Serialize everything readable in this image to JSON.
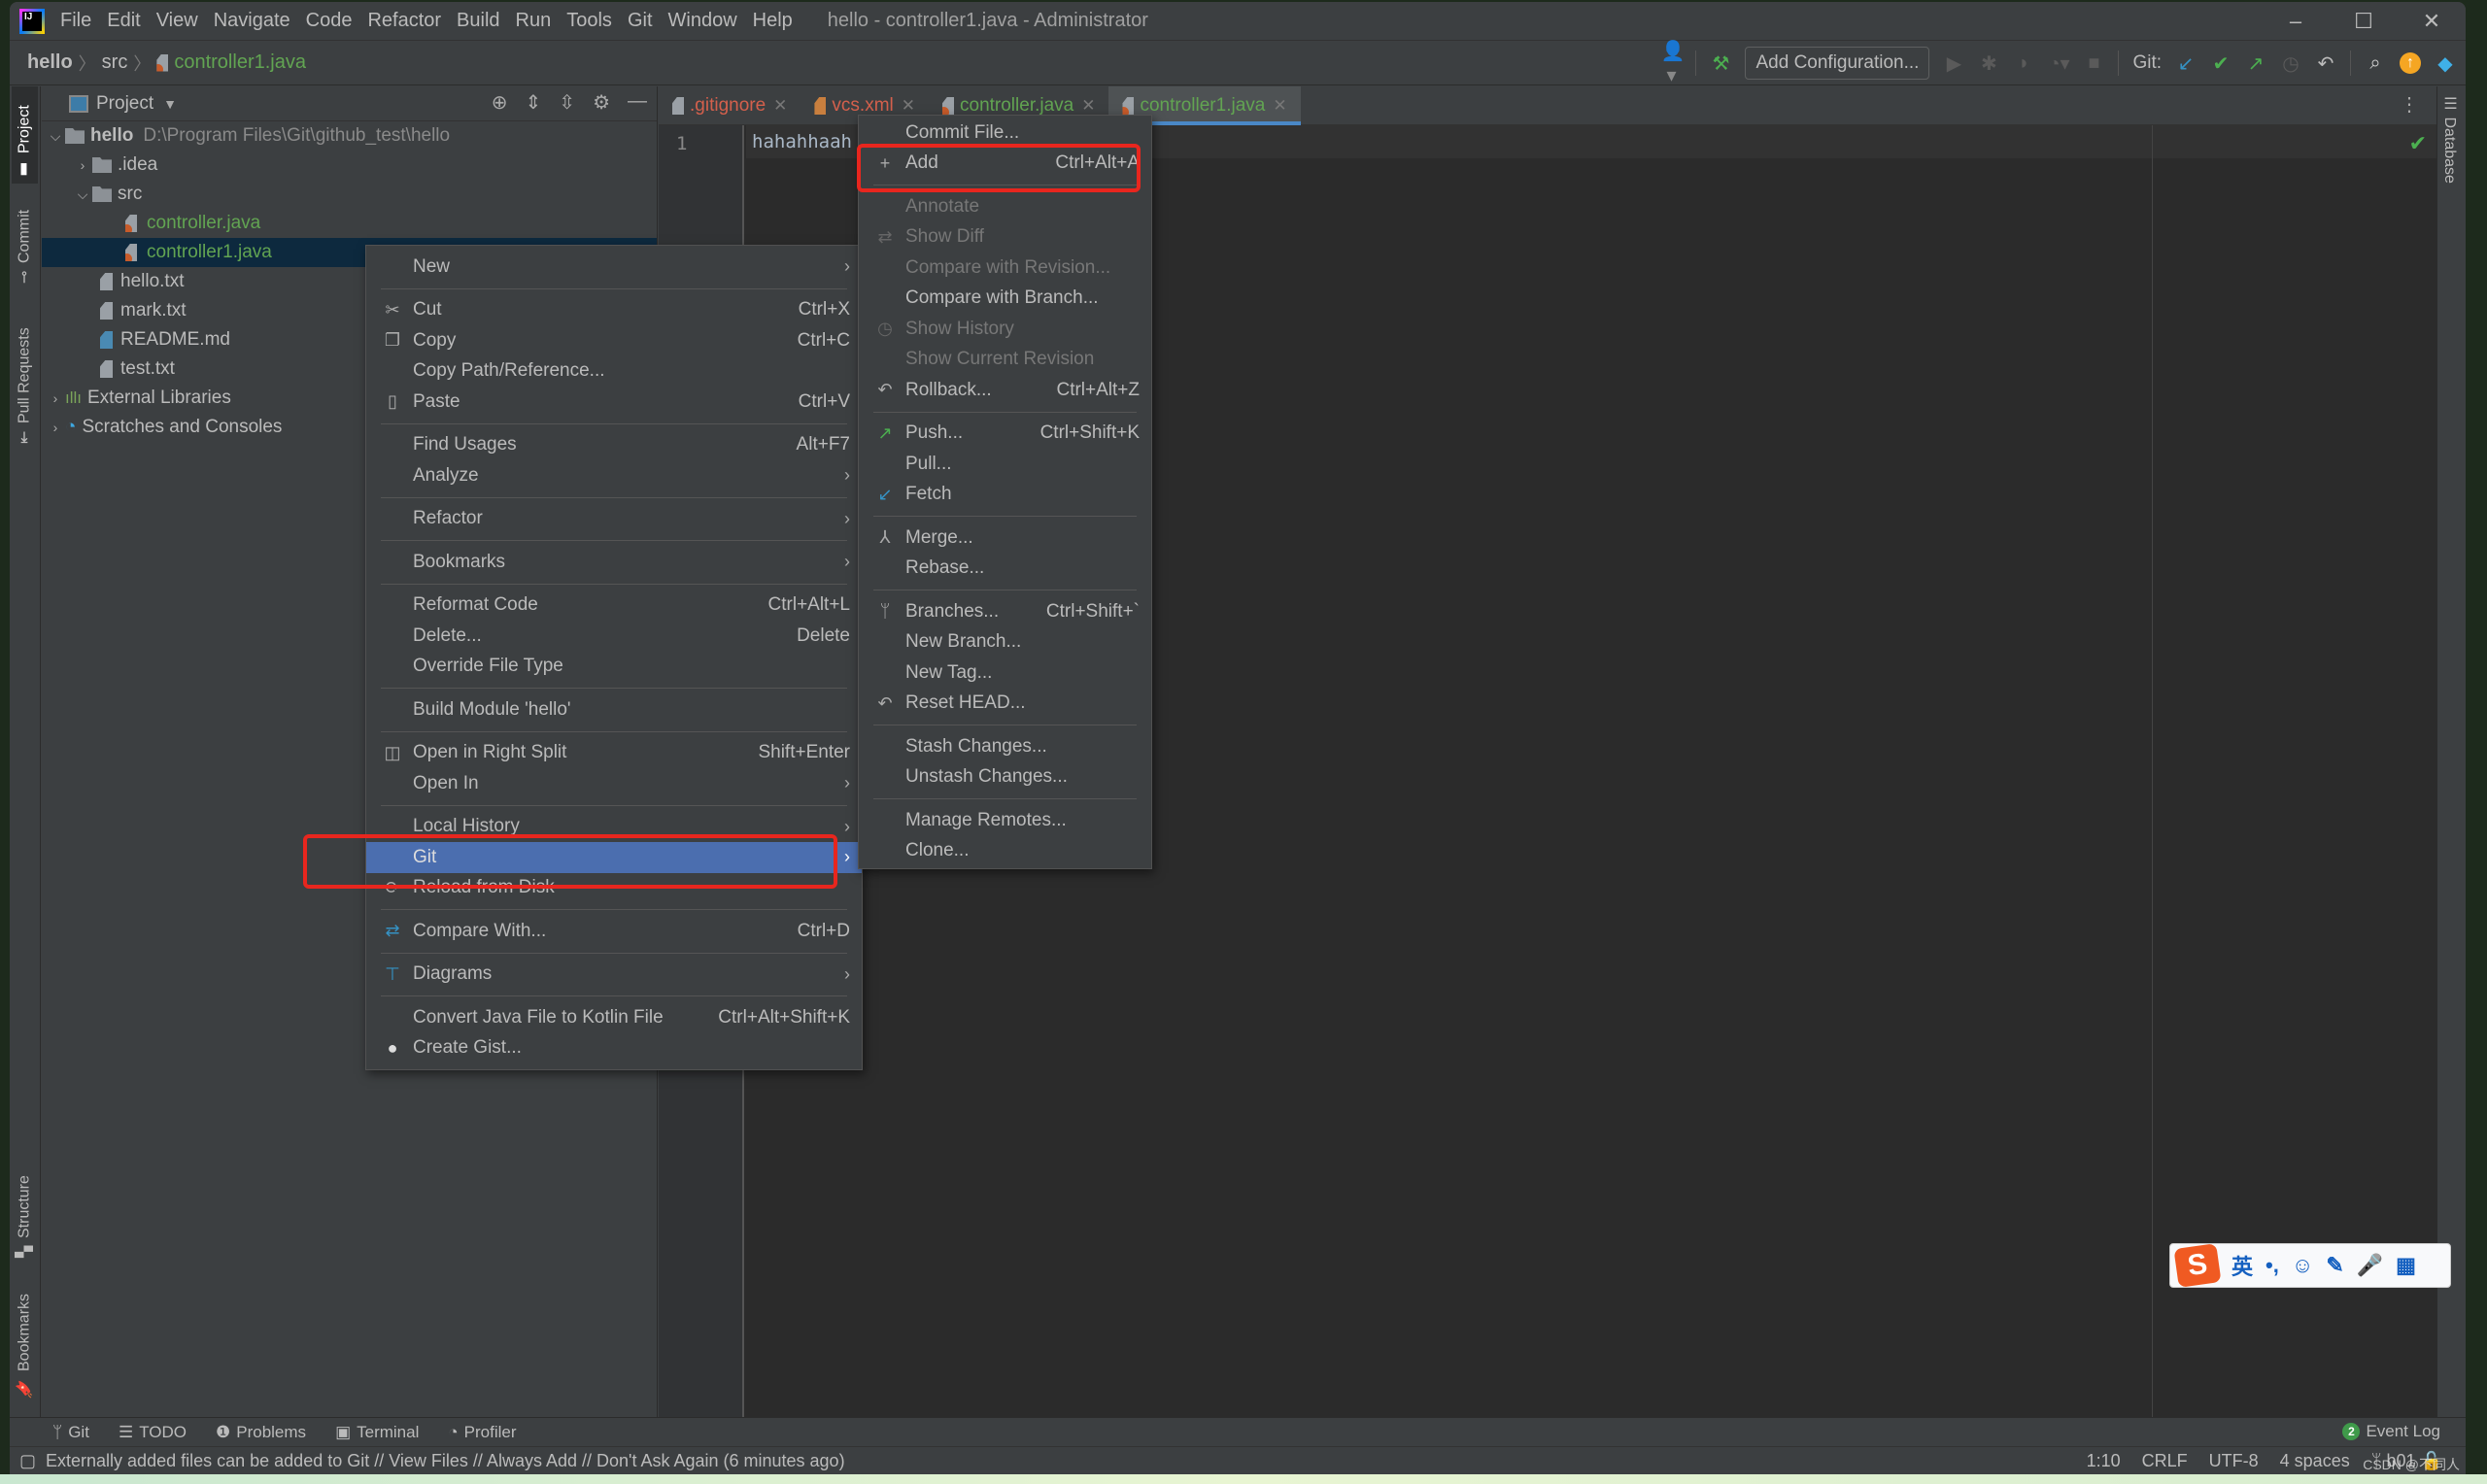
{
  "window": {
    "title": "hello - controller1.java - Administrator",
    "menu": [
      "File",
      "Edit",
      "View",
      "Navigate",
      "Code",
      "Refactor",
      "Build",
      "Run",
      "Tools",
      "Git",
      "Window",
      "Help"
    ],
    "controls": {
      "minimize": "–",
      "maximize": "☐",
      "close": "✕"
    }
  },
  "breadcrumb": [
    "hello",
    "src",
    "controller1.java"
  ],
  "toolbar": {
    "add_configuration": "Add Configuration...",
    "git_label": "Git:"
  },
  "left_stripe": [
    "Project",
    "Commit",
    "Pull Requests",
    "Structure",
    "Bookmarks"
  ],
  "right_stripe": [
    "Database"
  ],
  "project_panel": {
    "title": "Project",
    "root": {
      "name": "hello",
      "path": "D:\\Program Files\\Git\\github_test\\hello"
    },
    "items": [
      {
        "name": ".idea",
        "type": "folder"
      },
      {
        "name": "src",
        "type": "folder"
      },
      {
        "name": "controller.java",
        "type": "java"
      },
      {
        "name": "controller1.java",
        "type": "java"
      },
      {
        "name": "hello.txt",
        "type": "text"
      },
      {
        "name": "mark.txt",
        "type": "text"
      },
      {
        "name": "README.md",
        "type": "md"
      },
      {
        "name": "test.txt",
        "type": "text"
      },
      {
        "name": "External Libraries",
        "type": "lib"
      },
      {
        "name": "Scratches and Consoles",
        "type": "scratch"
      }
    ]
  },
  "editor": {
    "tabs": [
      {
        "label": ".gitignore"
      },
      {
        "label": "vcs.xml"
      },
      {
        "label": "controller.java"
      },
      {
        "label": "controller1.java",
        "active": true
      }
    ],
    "line_number": "1",
    "code": "hahahhaah"
  },
  "context_menu": {
    "items": [
      {
        "label": "New",
        "submenu": true
      },
      {
        "label": "Cut",
        "shortcut": "Ctrl+X",
        "icon": "scissors"
      },
      {
        "label": "Copy",
        "shortcut": "Ctrl+C",
        "icon": "copy"
      },
      {
        "label": "Copy Path/Reference..."
      },
      {
        "label": "Paste",
        "shortcut": "Ctrl+V",
        "icon": "clipboard"
      },
      {
        "label": "Find Usages",
        "shortcut": "Alt+F7"
      },
      {
        "label": "Analyze",
        "submenu": true
      },
      {
        "label": "Refactor",
        "submenu": true
      },
      {
        "label": "Bookmarks",
        "submenu": true
      },
      {
        "label": "Reformat Code",
        "shortcut": "Ctrl+Alt+L"
      },
      {
        "label": "Delete...",
        "shortcut": "Delete"
      },
      {
        "label": "Override File Type"
      },
      {
        "label": "Build Module 'hello'"
      },
      {
        "label": "Open in Right Split",
        "shortcut": "Shift+Enter",
        "icon": "split"
      },
      {
        "label": "Open In",
        "submenu": true
      },
      {
        "label": "Local History",
        "submenu": true
      },
      {
        "label": "Git",
        "submenu": true,
        "highlighted": true
      },
      {
        "label": "Reload from Disk",
        "icon": "reload"
      },
      {
        "label": "Compare With...",
        "shortcut": "Ctrl+D",
        "icon": "compare"
      },
      {
        "label": "Diagrams",
        "submenu": true,
        "icon": "diagram"
      },
      {
        "label": "Convert Java File to Kotlin File",
        "shortcut": "Ctrl+Alt+Shift+K"
      },
      {
        "label": "Create Gist...",
        "icon": "github"
      }
    ]
  },
  "git_submenu": {
    "items": [
      {
        "label": "Commit File..."
      },
      {
        "label": "Add",
        "shortcut": "Ctrl+Alt+A",
        "icon": "plus"
      },
      {
        "label": "Annotate",
        "disabled": true
      },
      {
        "label": "Show Diff",
        "disabled": true,
        "icon": "diff"
      },
      {
        "label": "Compare with Revision...",
        "disabled": true
      },
      {
        "label": "Compare with Branch..."
      },
      {
        "label": "Show History",
        "disabled": true,
        "icon": "clock"
      },
      {
        "label": "Show Current Revision",
        "disabled": true
      },
      {
        "label": "Rollback...",
        "shortcut": "Ctrl+Alt+Z",
        "icon": "undo"
      },
      {
        "label": "Push...",
        "shortcut": "Ctrl+Shift+K",
        "icon": "push"
      },
      {
        "label": "Pull..."
      },
      {
        "label": "Fetch",
        "icon": "fetch"
      },
      {
        "label": "Merge...",
        "icon": "merge"
      },
      {
        "label": "Rebase..."
      },
      {
        "label": "Branches...",
        "shortcut": "Ctrl+Shift+`",
        "icon": "branch"
      },
      {
        "label": "New Branch..."
      },
      {
        "label": "New Tag..."
      },
      {
        "label": "Reset HEAD...",
        "icon": "undo"
      },
      {
        "label": "Stash Changes..."
      },
      {
        "label": "Unstash Changes..."
      },
      {
        "label": "Manage Remotes..."
      },
      {
        "label": "Clone..."
      }
    ]
  },
  "bottom_tools": [
    "Git",
    "TODO",
    "Problems",
    "Terminal",
    "Profiler"
  ],
  "event_log": {
    "label": "Event Log",
    "count": "2"
  },
  "status": {
    "message": "Externally added files can be added to Git // View Files // Always Add // Don't Ask Again (6 minutes ago)",
    "position": "1:10",
    "line_sep": "CRLF",
    "encoding": "UTF-8",
    "indent": "4 spaces",
    "branch": "b01"
  },
  "watermark": "CSDN @不同人",
  "ime": {
    "logo": "S",
    "lang": "英",
    "punct": "•,"
  },
  "colors": {
    "accent": "#4b6eaf",
    "highlight_box": "#e8261e",
    "tab_underline": "#4a88c7",
    "vcs_added": "#62a452"
  }
}
